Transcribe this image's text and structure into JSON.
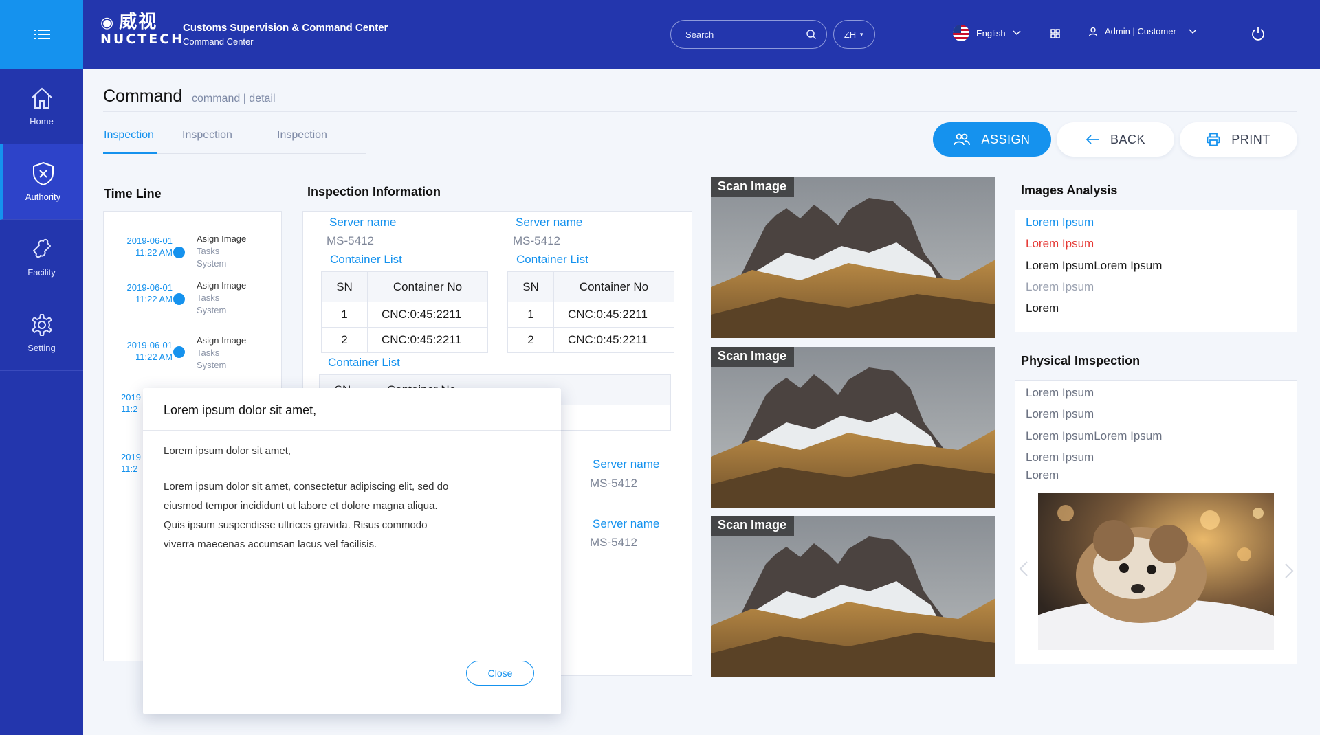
{
  "header": {
    "brand_logo": "NUCTECH",
    "brand_logo_cn": "威视",
    "title": "Customs Supervision & Command Center",
    "subtitle": "Command Center",
    "search_placeholder": "Search",
    "lang_short": "ZH",
    "language": "English",
    "user": "Admin | Customer",
    "accent": "#1592ee",
    "bg": "#2336ad"
  },
  "sidebar": {
    "items": [
      {
        "label": "Home",
        "icon": "home-icon"
      },
      {
        "label": "Authority",
        "icon": "shield-icon",
        "active": true
      },
      {
        "label": "Facility",
        "icon": "puzzle-icon"
      },
      {
        "label": "Setting",
        "icon": "gear-icon"
      }
    ]
  },
  "page": {
    "title": "Command",
    "crumb": "command | detail",
    "tabs": [
      "Inspection",
      "Inspection",
      "Inspection"
    ]
  },
  "actions": {
    "assign": "ASSIGN",
    "back": "BACK",
    "print": "PRINT"
  },
  "timeline": {
    "title": "Time Line",
    "items": [
      {
        "date": "2019-06-01",
        "time": "11:22 AM",
        "action": "Asign Image",
        "line2": "Tasks",
        "line3": "System"
      },
      {
        "date": "2019-06-01",
        "time": "11:22 AM",
        "action": "Asign Image",
        "line2": "Tasks",
        "line3": "System"
      },
      {
        "date": "2019-06-01",
        "time": "11:22 AM",
        "action": "Asign Image",
        "line2": "Tasks",
        "line3": "System"
      },
      {
        "date": "2019",
        "time": "11:2"
      },
      {
        "date": "2019",
        "time": "11:2"
      }
    ]
  },
  "inspection": {
    "title": "Inspection Information",
    "server_label": "Server name",
    "server_value": "MS-5412",
    "container_list_label": "Container List",
    "col_sn": "SN",
    "col_container": "Container No",
    "rows": [
      {
        "sn": "1",
        "no": "CNC:0:45:2211"
      },
      {
        "sn": "2",
        "no": "CNC:0:45:2211"
      }
    ]
  },
  "scans": {
    "label": "Scan Image"
  },
  "analysis": {
    "title": "Images Analysis",
    "items": [
      {
        "text": "Lorem Ipsum",
        "color": "#1592ee"
      },
      {
        "text": "Lorem Ipsum",
        "color": "#e53935"
      },
      {
        "text": "Lorem IpsumLorem Ipsum",
        "color": "#1b1b1b"
      },
      {
        "text": "Lorem Ipsum",
        "color": "#9aa1b0"
      },
      {
        "text": "Lorem",
        "color": "#1b1b1b"
      }
    ]
  },
  "physical": {
    "title": "Physical Imspection",
    "items": [
      "Lorem Ipsum",
      "Lorem Ipsum",
      "Lorem IpsumLorem Ipsum",
      "Lorem Ipsum",
      "Lorem"
    ]
  },
  "dialog": {
    "title": "Lorem ipsum dolor sit amet,",
    "subtitle": "Lorem ipsum dolor sit amet,",
    "body_lines": [
      "Lorem ipsum dolor sit amet, consectetur adipiscing elit, sed do",
      "eiusmod tempor incididunt ut labore et dolore magna aliqua.",
      "Quis ipsum suspendisse ultrices gravida. Risus commodo",
      "viverra maecenas accumsan lacus vel facilisis."
    ],
    "close": "Close"
  }
}
